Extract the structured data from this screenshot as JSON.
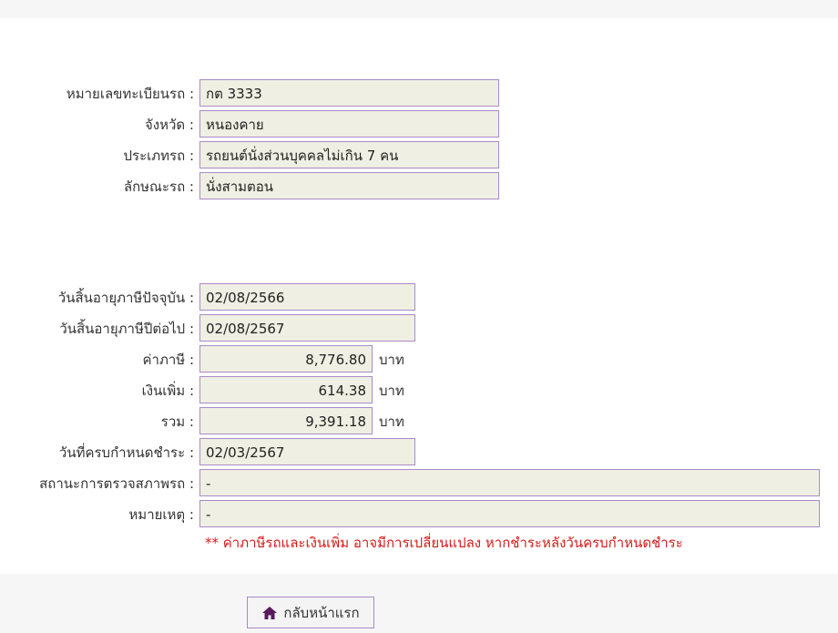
{
  "vehicle": {
    "plate_label": "หมายเลขทะเบียนรถ :",
    "plate_value": "กต 3333",
    "province_label": "จังหวัด :",
    "province_value": "หนองคาย",
    "type_label": "ประเภทรถ :",
    "type_value": "รถยนต์นั่งส่วนบุคคลไม่เกิน 7 คน",
    "style_label": "ลักษณะรถ :",
    "style_value": "นั่งสามตอน"
  },
  "tax": {
    "current_expiry_label": "วันสิ้นอายุภาษีปัจจุบัน :",
    "current_expiry_value": "02/08/2566",
    "next_expiry_label": "วันสิ้นอายุภาษีปีต่อไป :",
    "next_expiry_value": "02/08/2567",
    "tax_label": "ค่าภาษี :",
    "tax_value": "8,776.80",
    "surcharge_label": "เงินเพิ่ม :",
    "surcharge_value": "614.38",
    "total_label": "รวม :",
    "total_value": "9,391.18",
    "unit": "บาท",
    "due_date_label": "วันที่ครบกำหนดชำระ :",
    "due_date_value": "02/03/2567",
    "inspection_label": "สถานะการตรวจสภาพรถ :",
    "inspection_value": "-",
    "remark_label": "หมายเหตุ :",
    "remark_value": "-"
  },
  "note": "** ค่าภาษีรถและเงินเพิ่ม อาจมีการเปลี่ยนแปลง หากชำระหลังวันครบกำหนดชำระ",
  "home_button": {
    "label": "กลับหน้าแรก",
    "icon": "home-icon"
  },
  "colors": {
    "field_border": "#a98bc6",
    "field_bg": "#efefe3",
    "note": "#d61a1a",
    "icon": "#5a1a5e"
  }
}
